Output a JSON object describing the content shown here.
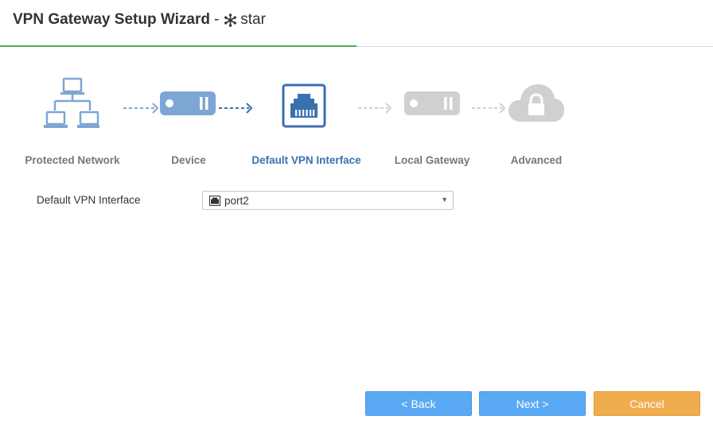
{
  "dialog": {
    "title": "VPN Gateway Setup Wizard",
    "title_separator": "-",
    "vdom_name": "star",
    "vdom_icon": "snowflake-icon"
  },
  "wizard": {
    "steps": [
      {
        "label": "Protected Network",
        "icon": "network-topology-icon",
        "state": "done"
      },
      {
        "label": "Device",
        "icon": "device-icon",
        "state": "done"
      },
      {
        "label": "Default VPN Interface",
        "icon": "ethernet-port-icon",
        "state": "active"
      },
      {
        "label": "Local Gateway",
        "icon": "gateway-icon",
        "state": "pending"
      },
      {
        "label": "Advanced",
        "icon": "cloud-lock-icon",
        "state": "pending"
      }
    ],
    "colors": {
      "done": "#7ea6d4",
      "active": "#3a70b0",
      "pending": "#d0d0d0",
      "progress": "#4caf50"
    }
  },
  "form": {
    "interface_label": "Default VPN Interface",
    "interface_value": "port2",
    "interface_icon": "ethernet-port-icon"
  },
  "buttons": {
    "back": "< Back",
    "next": "Next >",
    "cancel": "Cancel"
  }
}
